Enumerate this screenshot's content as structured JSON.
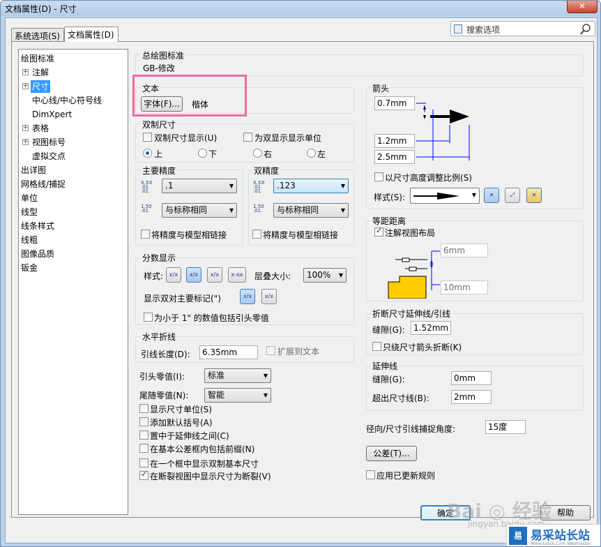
{
  "window": {
    "title": "文档属性(D) - 尺寸",
    "close": "✕"
  },
  "tabs": [
    {
      "label": "系统选项(S)"
    },
    {
      "label": "文档属性(D)"
    }
  ],
  "search": {
    "placeholder": "搜索选项"
  },
  "tree": [
    "绘图标准",
    "注解",
    "尺寸",
    "中心线/中心符号线",
    "DimXpert",
    "表格",
    "视图标号",
    "虚拟交点",
    "出详图",
    "网格线/捕捉",
    "单位",
    "线型",
    "线条样式",
    "线粗",
    "图像品质",
    "钣金"
  ],
  "overall": {
    "title": "总绘图标准",
    "value": "GB-修改"
  },
  "text": {
    "title": "文本",
    "font_button": "字体(F)...",
    "font_name": "楷体"
  },
  "dual": {
    "title": "双制尺寸",
    "show": "双制尺寸显示(U)",
    "show_units": "为双显示显示单位",
    "top": "上",
    "bottom": "下",
    "right": "右",
    "left": "左"
  },
  "primary": {
    "title": "主要精度",
    "value": ".1",
    "tol": "与标称相同",
    "link": "将精度与模型相链接",
    "icon_a": "X.XX\n.01\n.01",
    "icon_b": "1.50\n.01"
  },
  "dualprec": {
    "title": "双精度",
    "value": ".123",
    "tol": "与标称相同",
    "link": "将精度与模型相链接"
  },
  "fraction": {
    "title": "分数显示",
    "style": "样式:",
    "stack": "层叠大小:",
    "stack_value": "100%",
    "dual_mark": "显示双对主要标记(\")",
    "lead": "为小于 1\" 的数值包括引头零值",
    "icons": [
      "x/x",
      "x/x",
      "x/x",
      "x-xx"
    ],
    "icons2": [
      "x/x",
      "x/x"
    ]
  },
  "bent": {
    "title": "水平折线",
    "leader_len": "引线长度(D):",
    "leader_value": "6.35mm",
    "extend": "扩展到文本"
  },
  "zeros": {
    "lead": "引头零值(I):",
    "lead_value": "标准",
    "trail": "尾随零值(N):",
    "trail_value": "智能"
  },
  "checks": [
    {
      "label": "显示尺寸单位(S)",
      "on": false
    },
    {
      "label": "添加默认括号(A)",
      "on": false
    },
    {
      "label": "置中于延伸线之间(C)",
      "on": false
    },
    {
      "label": "在基本公差框内包括前缀(N)",
      "on": false
    },
    {
      "label": "在一个框中显示双制基本尺寸",
      "on": false
    },
    {
      "label": "在断裂视图中显示尺寸为断裂(V)",
      "on": true
    }
  ],
  "arrows": {
    "title": "箭头",
    "v1": "0.7mm",
    "v2": "1.2mm",
    "v3": "2.5mm",
    "scale": "以尺寸高度调整比例(S)",
    "style": "样式(S):"
  },
  "offset": {
    "title": "等距距离",
    "snap": "注解视图布局",
    "v1": "6mm",
    "v2": "10mm"
  },
  "broken": {
    "title": "折断尺寸延伸线/引线",
    "gap": "缝隙(G):",
    "gap_value": "1.52mm",
    "only": "只绕尺寸箭头折断(K)"
  },
  "ext": {
    "title": "延伸线",
    "gap": "缝隙(G):",
    "gap_value": "0mm",
    "beyond": "超出尺寸线(B):",
    "beyond_value": "2mm"
  },
  "radial": {
    "label": "径向/尺寸引线捕捉角度:",
    "value": "15度"
  },
  "tolerance": {
    "button": "公差(T)...",
    "apply": "应用已更新规则"
  },
  "footer": {
    "ok": "确定",
    "help": "帮助"
  },
  "watermark": {
    "text1": "Bai ◎ 经验",
    "text2": "jingyan.baidu.com",
    "badge_icon": "易",
    "badge_title": "易采站长站",
    "badge_sub": "Www.Easck.Com Webmaster"
  },
  "colors": {
    "highlight": "#f069a8",
    "accent": "#3399ff"
  }
}
